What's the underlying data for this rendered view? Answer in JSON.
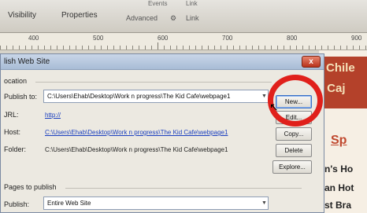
{
  "toolbar": {
    "visibility": "Visibility",
    "properties": "Properties",
    "events": "Events",
    "link_top": "Link",
    "advanced": "Advanced",
    "link": "Link"
  },
  "ruler": {
    "numbers": [
      "400",
      "500",
      "600",
      "700",
      "800",
      "900"
    ]
  },
  "dialog": {
    "title": "lish Web Site",
    "location_label": "ocation",
    "publish_to_label": "Publish to:",
    "publish_to_value": "C:\\Users\\Ehab\\Desktop\\Work n progress\\The Kid Cafe\\webpage1",
    "url_label": "JRL:",
    "url_value": "http://",
    "host_label": "Host:",
    "host_value": "C:\\Users\\Ehab\\Desktop\\Work n progress\\The Kid Cafe\\webpage1",
    "folder_label": "Folder:",
    "folder_value": "C:\\Users\\Ehab\\Desktop\\Work n progress\\The Kid Cafe\\webpage1",
    "pages_label": "Pages to publish",
    "publish_label": "Publish:",
    "publish_value": "Entire Web Site",
    "buttons": {
      "new": "New...",
      "edit": "Edit...",
      "copy": "Copy...",
      "delete": "Delete",
      "explore": "Explore..."
    },
    "close": "x"
  },
  "webpage": {
    "chile": "Chile",
    "caj": "t Caj",
    "sp": "Sp",
    "hot1": "n's Ho",
    "hot2": "an Hot",
    "bra": "st Bra"
  },
  "colors": {
    "annotation_ring": "#e0201b",
    "banner": "#b4412a",
    "link": "#1a3fbf"
  }
}
